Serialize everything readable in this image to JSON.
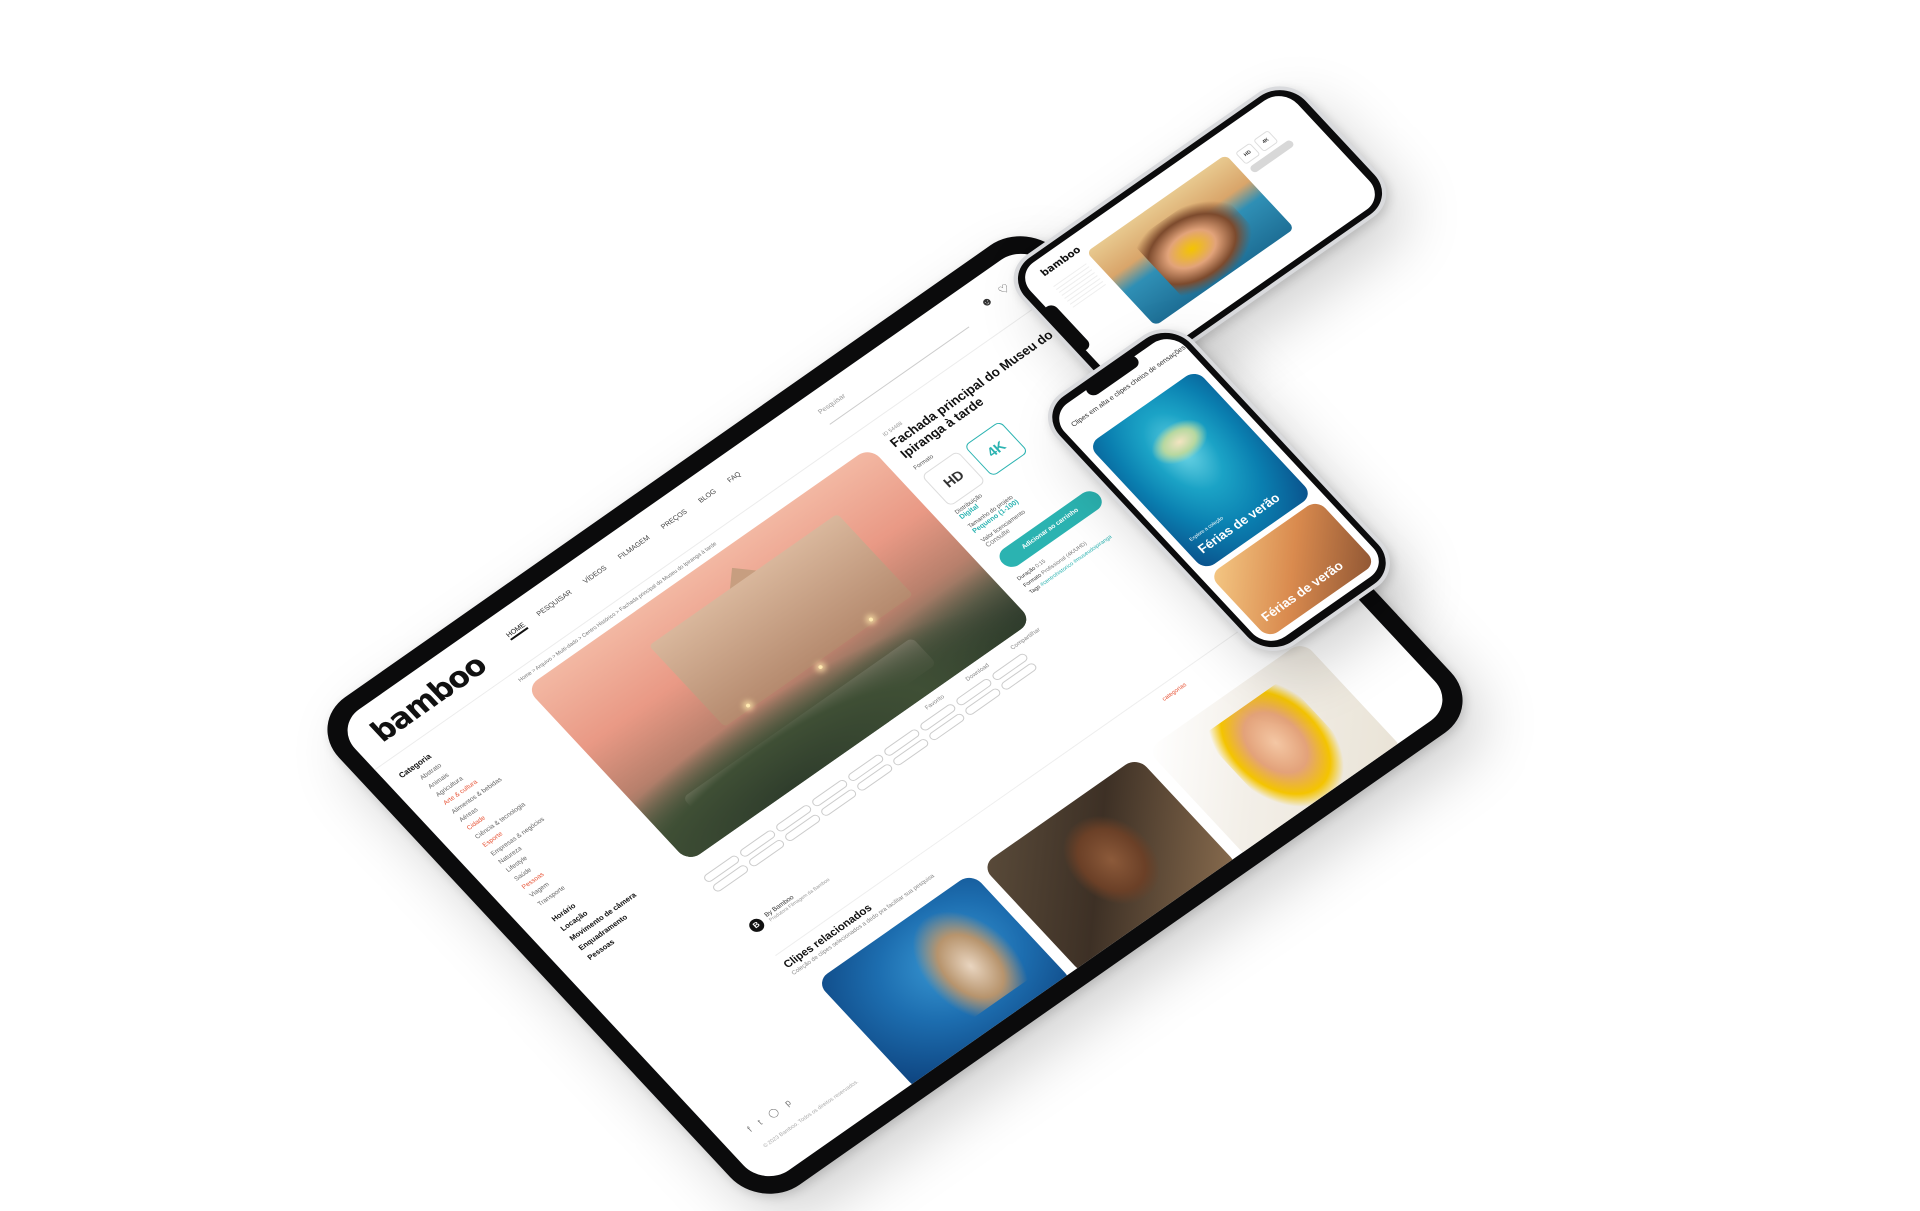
{
  "tablet": {
    "logo": "bamboo",
    "nav": [
      "HOME",
      "PESQUISAR",
      "VÍDEOS",
      "FILMAGEM",
      "PREÇOS",
      "BLOG",
      "FAQ"
    ],
    "search_placeholder": "Pesquisar",
    "breadcrumb": "Home > Arquivo > Multi-dado > Centro Histórico > Fachada principal do Museu do Ipiranga à tarde",
    "sidebar": {
      "category_title": "Categoria",
      "items": [
        "Abstrato",
        "Animais",
        "Agricultura",
        "Arte & cultura",
        "Alimentos & bebidas",
        "Aéreas",
        "Cidade",
        "Ciência & tecnologia",
        "Esporte",
        "Empresas & negócios",
        "Natureza",
        "Lifestyle",
        "Saúde",
        "Pessoas",
        "Viagem",
        "Transporte"
      ],
      "groups": [
        "Horário",
        "Locação",
        "Movimento de câmera",
        "Enquadramento",
        "Pessoas"
      ],
      "copyright": "© 2023 Bamboo. Todos os direitos reservados."
    },
    "actions": [
      "Favorito",
      "Download",
      "Compartilhar"
    ],
    "author": {
      "initial": "B",
      "name": "By Bamboo",
      "sub": "Produtora Filmagem da Bamboo"
    },
    "info": {
      "id": "ID 54488",
      "title": "Fachada principal do Museu do Ipiranga à tarde",
      "format_label": "Formato",
      "formats": [
        "HD",
        "4K"
      ],
      "distribution_label": "Distribuição",
      "distribution_value": "Digital",
      "size_label": "Tamanho do projeto",
      "size_value": "Pequeno (1-100)",
      "license_label": "Valor licenciamento",
      "license_value": "Consulte",
      "cart_button": "Adicionar ao carrinho",
      "meta": [
        [
          "Duração",
          "0:15"
        ],
        [
          "Formato",
          "Profissional (4K/UHD)"
        ],
        [
          "Tags",
          "#centrohistorico #museudoipiranga"
        ]
      ]
    },
    "related": {
      "title": "Clipes relacionados",
      "subtitle": "Coleção de clipes selecionados a dedo pra facilitar sua pesquisa",
      "link": "categorias"
    }
  },
  "phone_landscape": {
    "logo": "bamboo",
    "formats": [
      "HD",
      "4K"
    ]
  },
  "phone_portrait": {
    "top_text": "Clipes em alta e clipes cheios de sensações",
    "card1_sub": "Explore a coleção",
    "card1_title": "Férias de verão",
    "card2_title": "Férias de verão"
  },
  "colors": {
    "accent": "#2bb3b1",
    "highlight": "#e8573a",
    "device": "#0b0b0c"
  }
}
